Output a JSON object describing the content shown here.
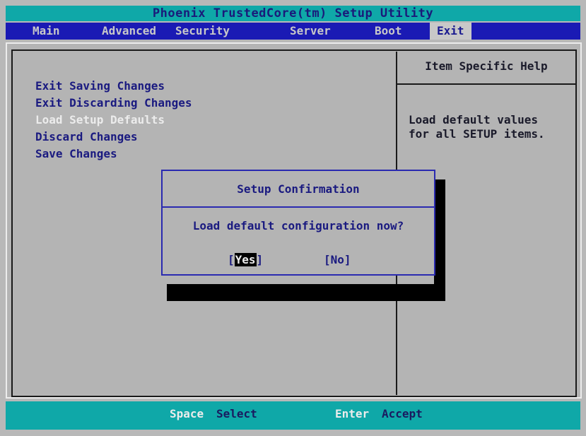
{
  "title": "Phoenix TrustedCore(tm) Setup Utility",
  "menu": {
    "items": [
      {
        "label": "Main"
      },
      {
        "label": "Advanced"
      },
      {
        "label": "Security"
      },
      {
        "label": "Server"
      },
      {
        "label": "Boot"
      },
      {
        "label": "Exit"
      }
    ],
    "active": "Exit"
  },
  "options": [
    {
      "label": "Exit Saving Changes"
    },
    {
      "label": "Exit Discarding Changes"
    },
    {
      "label": "Load Setup Defaults"
    },
    {
      "label": "Discard Changes"
    },
    {
      "label": "Save Changes"
    }
  ],
  "highlighted_option": "Load Setup Defaults",
  "help": {
    "title": "Item Specific Help",
    "line1": "Load default values",
    "line2": "for all SETUP items."
  },
  "dialog": {
    "title": "Setup Confirmation",
    "message": "Load default configuration now?",
    "yes_open": "[",
    "yes_label": "Yes",
    "yes_close": "]",
    "no_label": "[No]",
    "selected": "Yes"
  },
  "footer": {
    "key1": "Space",
    "desc1": "Select",
    "key2": "Enter",
    "desc2": "Accept"
  },
  "colors": {
    "menubar": "#1a1ab4",
    "titlebar": "#0fa8a8",
    "background": "#b8b8b8",
    "highlight_text": "#ececec"
  }
}
